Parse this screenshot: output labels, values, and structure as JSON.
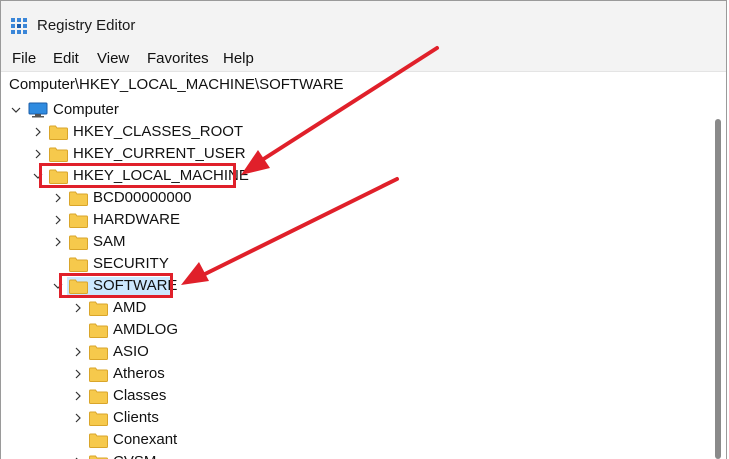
{
  "window": {
    "title": "Registry Editor",
    "app_icon": "registry-icon"
  },
  "menu": {
    "items": [
      "File",
      "Edit",
      "View",
      "Favorites",
      "Help"
    ]
  },
  "address": {
    "path": "Computer\\HKEY_LOCAL_MACHINE\\SOFTWARE"
  },
  "tree": {
    "root": "Computer",
    "hives": [
      {
        "label": "HKEY_CLASSES_ROOT",
        "expanded": false
      },
      {
        "label": "HKEY_CURRENT_USER",
        "expanded": false
      },
      {
        "label": "HKEY_LOCAL_MACHINE",
        "expanded": true,
        "highlighted": true
      }
    ],
    "hklm_children": [
      {
        "label": "BCD00000000",
        "has_children": true
      },
      {
        "label": "HARDWARE",
        "has_children": true
      },
      {
        "label": "SAM",
        "has_children": true
      },
      {
        "label": "SECURITY",
        "has_children": false
      },
      {
        "label": "SOFTWARE",
        "has_children": true,
        "expanded": true,
        "selected": true,
        "highlighted": true
      }
    ],
    "software_children": [
      {
        "label": "AMD",
        "has_children": true
      },
      {
        "label": "AMDLOG",
        "has_children": false
      },
      {
        "label": "ASIO",
        "has_children": true
      },
      {
        "label": "Atheros",
        "has_children": true
      },
      {
        "label": "Classes",
        "has_children": true
      },
      {
        "label": "Clients",
        "has_children": true
      },
      {
        "label": "Conexant",
        "has_children": false
      },
      {
        "label": "CVSM",
        "has_children": true
      }
    ]
  },
  "colors": {
    "annotation_red": "#e0202a",
    "selection_blue": "#cce8ff",
    "folder_yellow": "#f6c94c"
  }
}
